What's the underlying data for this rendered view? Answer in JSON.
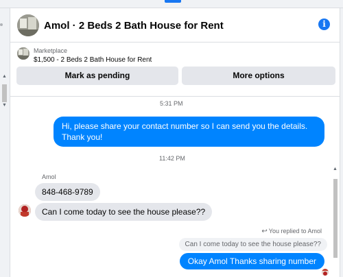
{
  "header": {
    "title": "Amol · 2 Beds 2 Bath House for Rent",
    "info_icon": "info-icon",
    "accent_color": "#1877f2"
  },
  "listing": {
    "label": "Marketplace",
    "title": "$1,500 - 2 Beds 2 Bath House for Rent",
    "mark_pending_label": "Mark as pending",
    "more_options_label": "More options"
  },
  "chat": {
    "timestamps": [
      "5:31 PM",
      "11:42 PM"
    ],
    "messages": [
      {
        "direction": "outgoing",
        "text": "Hi, please share your contact number so I can send you the details. Thank you!"
      },
      {
        "direction": "incoming",
        "sender": "Amol",
        "text": "848-468-9789"
      },
      {
        "direction": "incoming",
        "text": "Can I come today to see the house please??"
      },
      {
        "direction": "outgoing",
        "text": "Okay Amol Thanks sharing  number",
        "reply_indicator": "You replied to Amol",
        "quoted_text": "Can I come today to see the house please??"
      }
    ],
    "outgoing_color": "#0084ff",
    "incoming_color": "#e4e6eb"
  }
}
